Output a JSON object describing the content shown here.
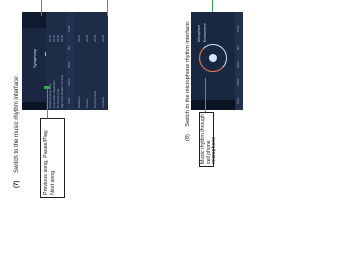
{
  "captions": {
    "step7": {
      "number": "(7)",
      "text": "Switch to the music rhythm interface:"
    },
    "step8": {
      "number": "(8)",
      "text": "Switch to the microphone rhythm interface:"
    }
  },
  "callouts": {
    "box7": "Previous song, Pause/Play, Next song",
    "box8": "Music rhythm through cell phone microphone"
  },
  "phone_music": {
    "header_title": "Symphony",
    "songs": [
      {
        "title": "Dream Chaser Amy",
        "time": "04:01"
      },
      {
        "title": "Love Letter Daydream",
        "time": "03:35"
      },
      {
        "title": "Bo Chuan Zhao",
        "time": "04:46"
      },
      {
        "title": "Night with Golden Phoenix",
        "time": "03:45"
      },
      {
        "title": "Evidence",
        "time": "04:20"
      },
      {
        "title": "Forever",
        "time": "02:30"
      },
      {
        "title": "Rhythm Heart",
        "time": "02:59"
      },
      {
        "title": "Treasure",
        "time": "03:05"
      }
    ],
    "dock": [
      "Color",
      "Scene",
      "Music",
      "Mic",
      "Timer"
    ]
  },
  "phone_mic": {
    "options": [
      "Microphone",
      "Environment"
    ],
    "dock": [
      "Color",
      "Scene",
      "Music",
      "Mic",
      "Timer"
    ]
  },
  "colors": {
    "accent": "#34a853",
    "screen": "#1a2740",
    "ring_arc": "#e0623a"
  }
}
